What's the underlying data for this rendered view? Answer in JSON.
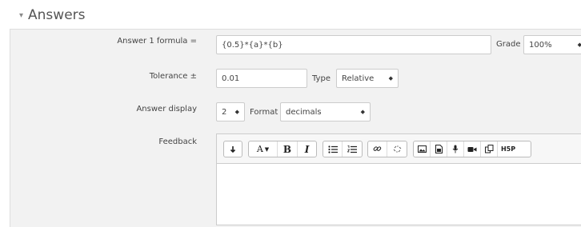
{
  "section": {
    "title": "Answers",
    "caret": "▾"
  },
  "formula": {
    "label": "Answer 1 formula =",
    "value": "{0.5}*{a}*{b}"
  },
  "grade": {
    "label": "Grade",
    "value": "100%"
  },
  "tolerance": {
    "label": "Tolerance ±",
    "value": "0.01"
  },
  "type": {
    "label": "Type",
    "value": "Relative"
  },
  "answer_display": {
    "label": "Answer display",
    "value": "2"
  },
  "format": {
    "label": "Format",
    "value": "decimals"
  },
  "feedback": {
    "label": "Feedback",
    "toolbar": {
      "collapse_icon": "expand-toolbar-icon",
      "font_glyph": "A",
      "bold_glyph": "B",
      "italic_glyph": "I",
      "h5p_label": "H5P"
    },
    "body": ""
  },
  "colors": {
    "panel_bg": "#f2f2f2",
    "border": "#cccccc",
    "text": "#444444"
  }
}
